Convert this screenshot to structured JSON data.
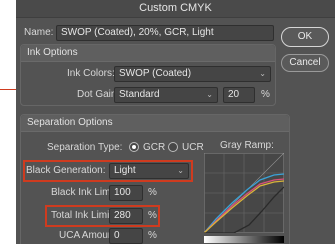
{
  "dialog": {
    "title": "Custom CMYK"
  },
  "name_field": {
    "label": "Name:",
    "value": "SWOP (Coated), 20%, GCR, Light"
  },
  "buttons": {
    "ok": "OK",
    "cancel": "Cancel"
  },
  "ink_options": {
    "title": "Ink Options",
    "ink_colors_label": "Ink Colors:",
    "ink_colors_value": "SWOP (Coated)",
    "dot_gain_label": "Dot Gain:",
    "dot_gain_mode": "Standard",
    "dot_gain_value": "20",
    "dot_gain_unit": "%"
  },
  "separation": {
    "title": "Separation Options",
    "type_label": "Separation Type:",
    "gcr_label": "GCR",
    "ucr_label": "UCR",
    "selected_type": "GCR",
    "gray_ramp_label": "Gray Ramp:",
    "black_generation_label": "Black Generation:",
    "black_generation_value": "Light",
    "black_ink_limit_label": "Black Ink Limit:",
    "black_ink_limit_value": "100",
    "total_ink_limit_label": "Total Ink Limit:",
    "total_ink_limit_value": "280",
    "uca_amount_label": "UCA Amount:",
    "uca_amount_value": "0",
    "unit": "%"
  },
  "colors": {
    "window_bg": "#535353",
    "highlight": "#cf3b1f",
    "curve_cyan": "#3aa3d8",
    "curve_magenta": "#d8507a",
    "curve_yellow": "#d8b43a",
    "curve_black": "#2a2a2a"
  },
  "icons": {
    "dropdown": "chevron-down-icon",
    "annotation": "callout-line"
  }
}
